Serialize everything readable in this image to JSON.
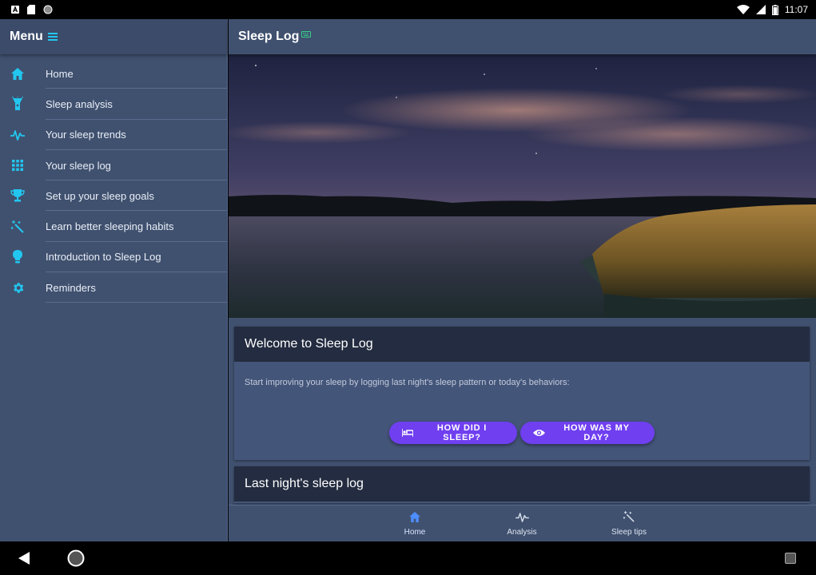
{
  "status_bar": {
    "time": "11:07",
    "icons": [
      "app-a-icon",
      "sd-card-icon",
      "circle-icon",
      "wifi-icon",
      "signal-icon",
      "battery-icon"
    ]
  },
  "sidebar": {
    "title": "Menu",
    "accent": "#22c7f0",
    "items": [
      {
        "label": "Home",
        "icon": "home-icon"
      },
      {
        "label": "Sleep analysis",
        "icon": "flashlight-icon"
      },
      {
        "label": "Your sleep trends",
        "icon": "pulse-icon"
      },
      {
        "label": "Your sleep log",
        "icon": "grid-icon"
      },
      {
        "label": "Set up your sleep goals",
        "icon": "trophy-icon"
      },
      {
        "label": "Learn better sleeping habits",
        "icon": "magic-wand-icon"
      },
      {
        "label": "Introduction to Sleep Log",
        "icon": "lightbulb-icon"
      },
      {
        "label": "Reminders",
        "icon": "gear-icon"
      }
    ]
  },
  "header": {
    "title": "Sleep Log",
    "badge_icon": "keyboard-icon"
  },
  "hero": {
    "description_icon": "landscape-image"
  },
  "welcome_card": {
    "title": "Welcome to Sleep Log",
    "text": "Start improving your sleep by logging last night's sleep pattern or today's behaviors:",
    "button_sleep": "HOW DID I SLEEP?",
    "button_day": "HOW WAS MY DAY?",
    "button_color": "#6f3ff0"
  },
  "lastnight_card": {
    "title": "Last night's sleep log"
  },
  "bottom_nav": {
    "items": [
      {
        "label": "Home",
        "icon": "home-icon",
        "active": true
      },
      {
        "label": "Analysis",
        "icon": "pulse-icon",
        "active": false
      },
      {
        "label": "Sleep tips",
        "icon": "magic-wand-icon",
        "active": false
      }
    ],
    "active_color": "#4d8dff"
  }
}
